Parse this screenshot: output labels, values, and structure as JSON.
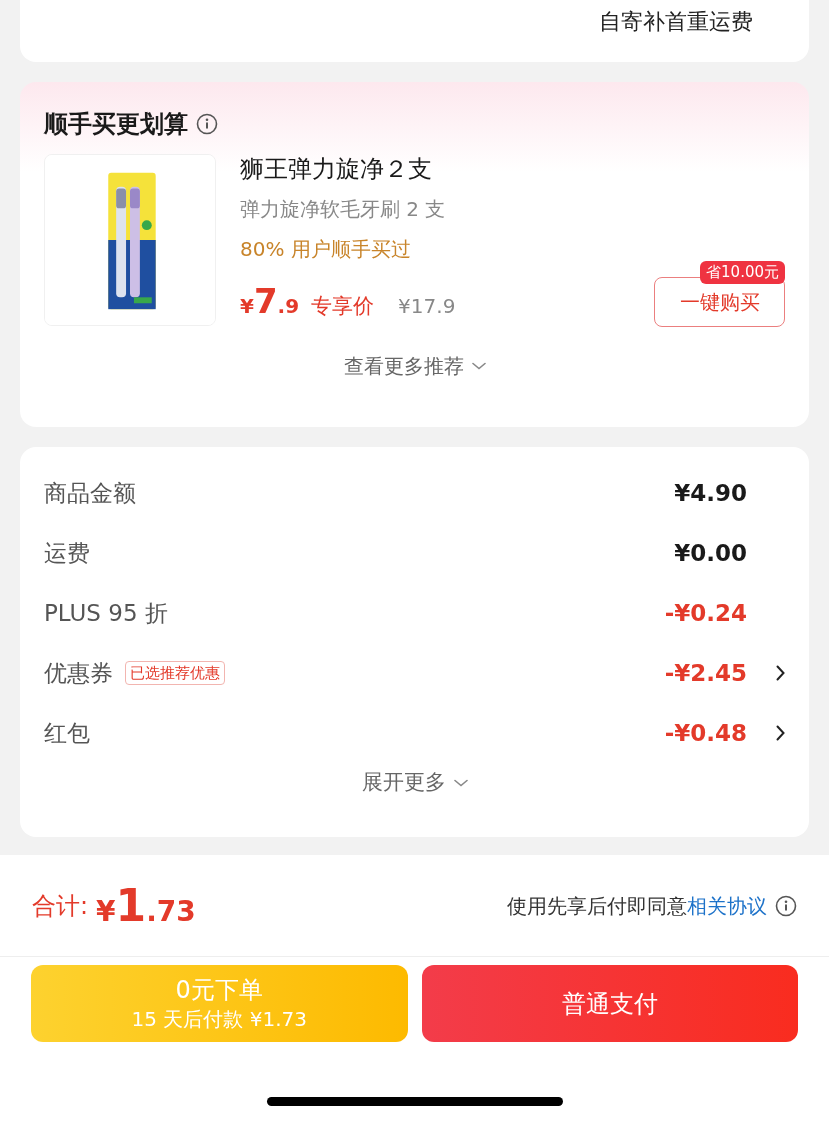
{
  "shipping_note": "自寄补首重运费",
  "addon": {
    "title": "顺手买更划算",
    "product": {
      "kind": "picture",
      "name": "狮王弹力旋净２支",
      "subtitle": "弹力旋净软毛牙刷 2 支",
      "social_proof": "80% 用户顺手买过",
      "price": {
        "currency": "¥",
        "integer": "7",
        "decimal": ".9"
      },
      "price_label": "专享价",
      "original_price": "¥17.9",
      "saving_badge": "省10.00元",
      "buy_button": "一键购买"
    },
    "more": "查看更多推荐"
  },
  "fees": {
    "rows": [
      {
        "kind": "plain",
        "label": "商品金额",
        "amount": "¥4.90",
        "arrow": false
      },
      {
        "kind": "plain",
        "label": "运费",
        "amount": "¥0.00",
        "arrow": false
      },
      {
        "kind": "discount",
        "label": "PLUS 95 折",
        "amount": "-¥0.24",
        "arrow": false
      },
      {
        "kind": "discount",
        "label": "优惠券",
        "tag": "已选推荐优惠",
        "amount": "-¥2.45",
        "arrow": true
      },
      {
        "kind": "discount",
        "label": "红包",
        "amount": "-¥0.48",
        "arrow": true
      }
    ],
    "more": "展开更多"
  },
  "footer": {
    "total_label": "合计:",
    "total": {
      "currency": "¥",
      "integer": "1",
      "decimal": ".73"
    },
    "agreement_text": "使用先享后付即同意",
    "agreement_link": "相关协议",
    "buttons": [
      {
        "kind": "later",
        "title": "0元下单",
        "subtitle": "15 天后付款 ¥1.73"
      },
      {
        "kind": "pay",
        "title": "普通支付"
      }
    ]
  }
}
